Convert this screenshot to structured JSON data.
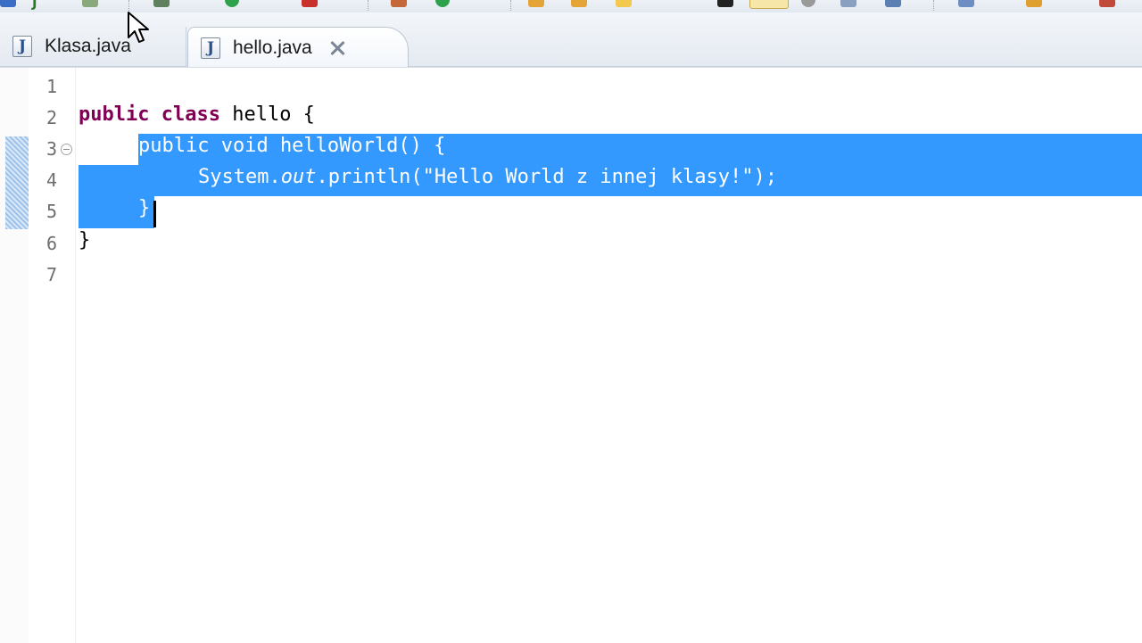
{
  "editor_tabs": [
    {
      "label": "Klasa.java",
      "icon_text": "J",
      "active": false
    },
    {
      "label": "hello.java",
      "icon_text": "J",
      "active": true
    }
  ],
  "line_numbers": [
    "1",
    "2",
    "3",
    "4",
    "5",
    "6",
    "7"
  ],
  "code": {
    "line2": {
      "kw1": "public",
      "kw2": "class",
      "rest": " hello {"
    },
    "line3": {
      "text": "public void helloWorld() {"
    },
    "line4": {
      "pre": "System.",
      "italic": "out",
      "post": ".println(\"Hello World z innej klasy!\");"
    },
    "line5": {
      "text": "}"
    },
    "line6": {
      "text": "}"
    }
  },
  "icons": {
    "tab_file": "java-file-icon",
    "tab_close": "close-icon",
    "fold": "collapse-icon",
    "pointer": "mouse-pointer-icon"
  },
  "colors": {
    "keyword": "#7f0055",
    "selection": "#3399ff",
    "selection_text": "#ffffff",
    "tab_active_bg": "#ffffff"
  }
}
